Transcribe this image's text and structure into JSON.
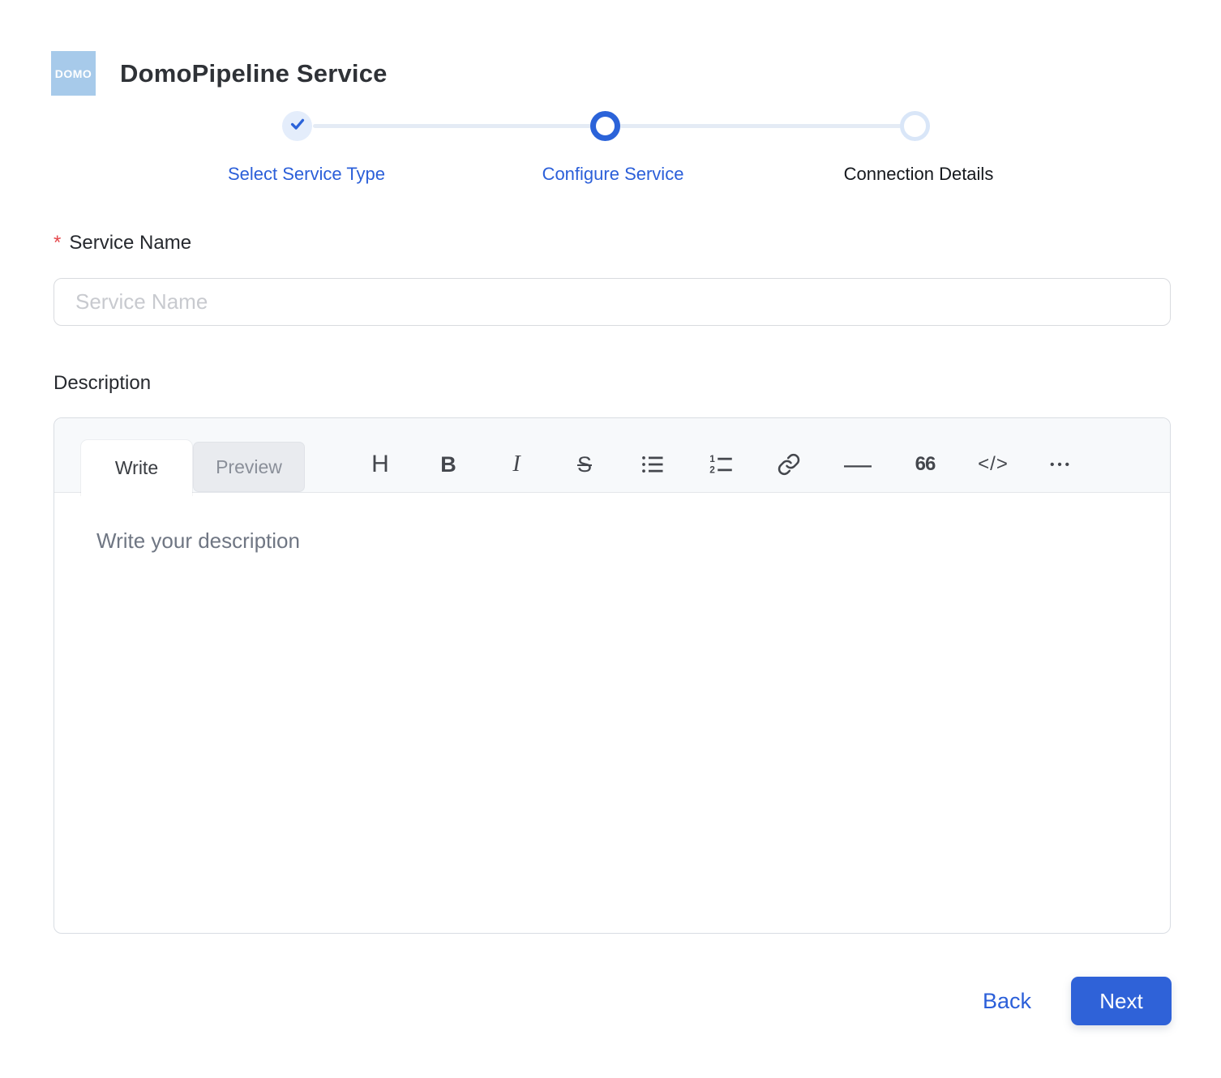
{
  "header": {
    "logo_text": "DOMO",
    "title": "DomoPipeline Service"
  },
  "stepper": {
    "steps": [
      {
        "label": "Select Service Type",
        "state": "completed"
      },
      {
        "label": "Configure Service",
        "state": "active"
      },
      {
        "label": "Connection Details",
        "state": "upcoming"
      }
    ]
  },
  "form": {
    "service_name": {
      "required_marker": "*",
      "label": "Service Name",
      "placeholder": "Service Name",
      "value": ""
    },
    "description": {
      "label": "Description",
      "tabs": {
        "write": "Write",
        "preview": "Preview"
      },
      "toolbar": {
        "heading_glyph": "H",
        "bold_glyph": "B",
        "italic_glyph": "I",
        "strikethrough_glyph": "S",
        "hr_glyph": "—",
        "quote_glyph": "66",
        "code_glyph": "</>",
        "more_glyph": "•••"
      },
      "placeholder": "Write your description"
    }
  },
  "footer": {
    "back_label": "Back",
    "next_label": "Next"
  },
  "colors": {
    "primary_button_blue": "#2F62D8",
    "link_blue": "#2B5FD9",
    "active_step_blue": "#2B63D9",
    "completed_step_bg": "#E4EDFB",
    "upcoming_step_ring": "#D9E6F8",
    "required_red": "#E5484D",
    "logo_bg": "#A7CAEA"
  }
}
